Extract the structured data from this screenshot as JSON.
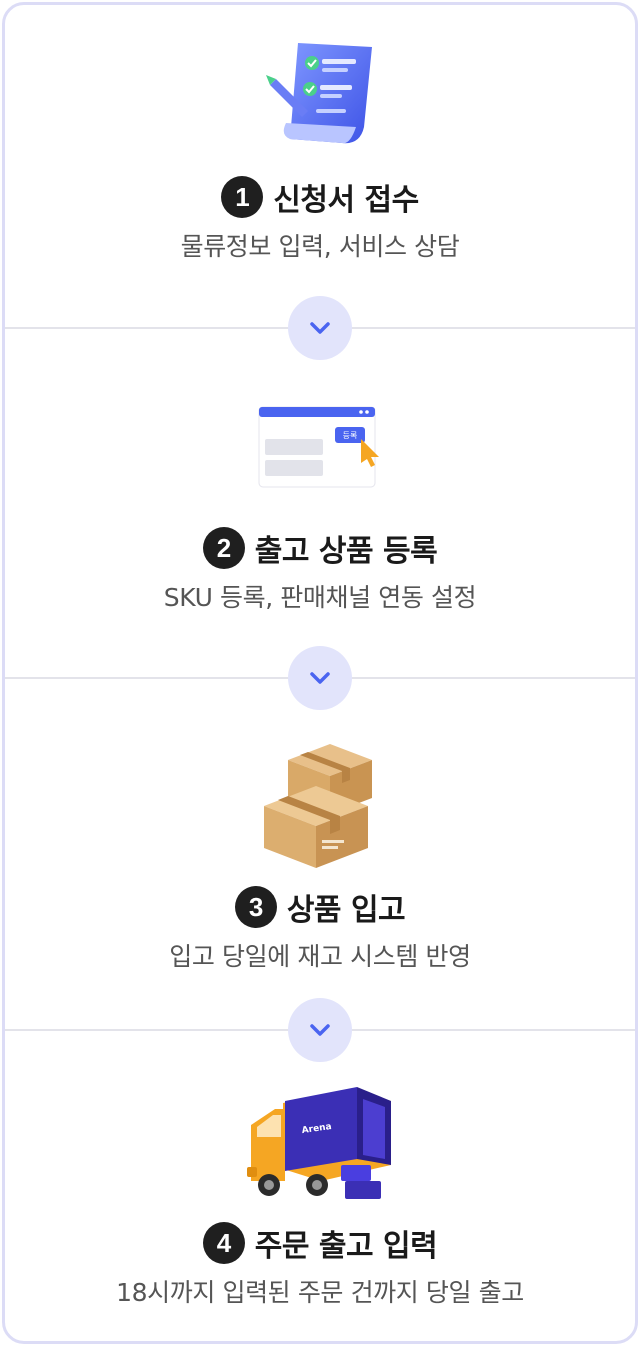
{
  "steps": [
    {
      "number": "1",
      "title": "신청서 접수",
      "description": "물류정보 입력, 서비스 상담",
      "icon": "document-checklist-icon"
    },
    {
      "number": "2",
      "title": "출고 상품 등록",
      "description": "SKU 등록, 판매채널 연동 설정",
      "icon": "register-window-icon",
      "button_label": "등록"
    },
    {
      "number": "3",
      "title": "상품 입고",
      "description": "입고 당일에 재고 시스템 반영",
      "icon": "boxes-icon"
    },
    {
      "number": "4",
      "title": "주문 출고 입력",
      "description": "18시까지 입력된 주문 건까지 당일 출고",
      "icon": "delivery-truck-icon"
    }
  ],
  "colors": {
    "accent": "#4a64f0",
    "arrow_bg": "#e2e4fb",
    "border": "#dcdcf6",
    "number_bg": "#1f1f1f"
  }
}
